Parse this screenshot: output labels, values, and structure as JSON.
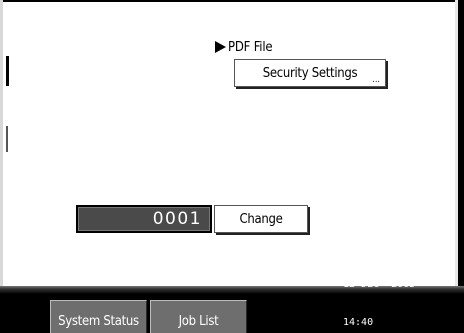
{
  "panel": {
    "section_label": "PDF File",
    "section_icon": "play-triangle-icon",
    "security_button_label": "Security Settings",
    "security_button_ellipsis": "...",
    "counter_value": "0001",
    "change_button_label": "Change"
  },
  "footer": {
    "system_status_label": "System Status",
    "job_list_label": "Job List",
    "date": "12 DEC  2005",
    "time": "14:40"
  }
}
